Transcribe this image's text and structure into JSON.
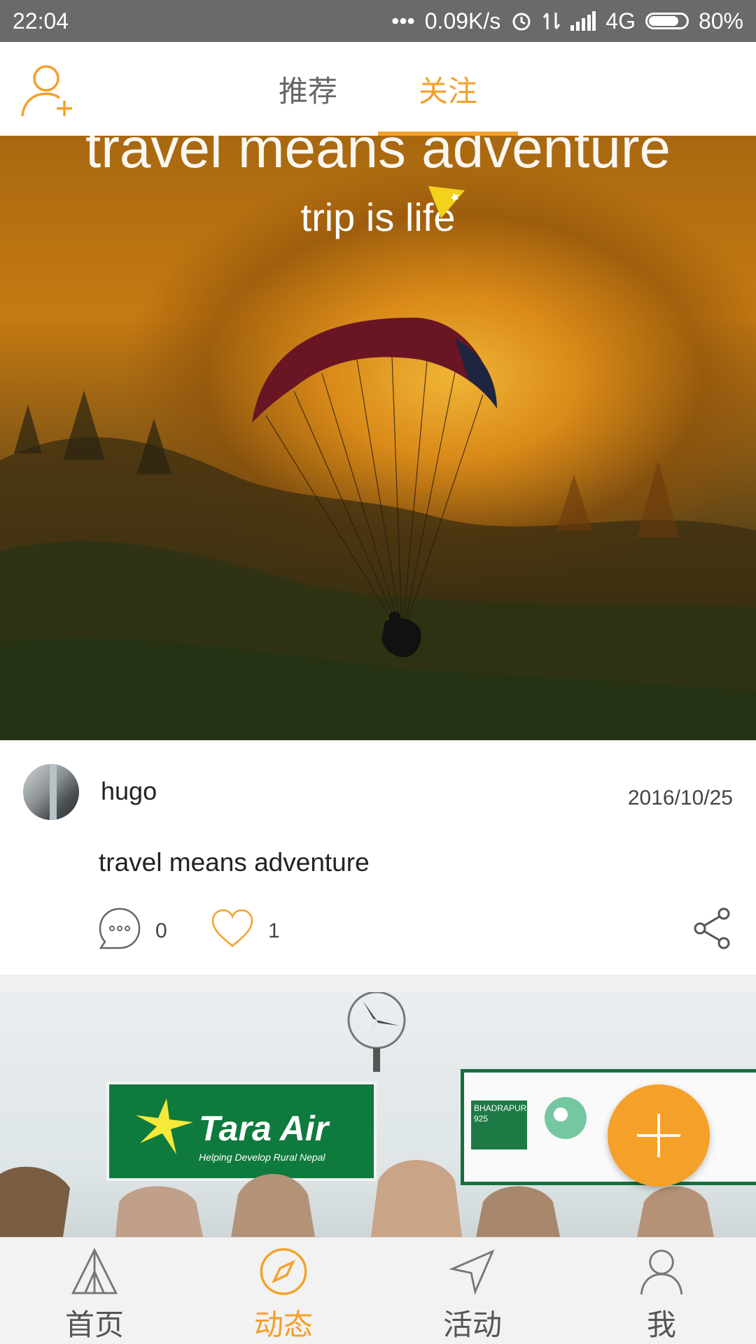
{
  "status_bar": {
    "time": "22:04",
    "network_speed": "0.09K/s",
    "network_type": "4G",
    "battery": "80%",
    "battery_level": 0.8
  },
  "header": {
    "tabs": [
      {
        "label": "推荐",
        "active": false
      },
      {
        "label": "关注",
        "active": true
      }
    ],
    "add_user_icon": "add-user-icon"
  },
  "posts": [
    {
      "image_caption": "travel means adventure",
      "image_brand": "trip is life",
      "username": "hugo",
      "date": "2016/10/25",
      "text": "travel means adventure",
      "comments": "0",
      "likes": "1"
    },
    {
      "sign_title": "Tara Air",
      "sign_subtitle": "Helping Develop Rural Nepal",
      "sign_bhadrapur": "BHADRAPUR",
      "sign_flight": "925"
    }
  ],
  "fab": {
    "icon": "plus-icon"
  },
  "bottom_nav": [
    {
      "label": "首页",
      "icon": "tent-icon",
      "active": false
    },
    {
      "label": "动态",
      "icon": "compass-icon",
      "active": true
    },
    {
      "label": "活动",
      "icon": "navigation-icon",
      "active": false
    },
    {
      "label": "我",
      "icon": "user-icon",
      "active": false
    }
  ],
  "colors": {
    "accent": "#f5a028",
    "status_bar": "#6a6a6a",
    "nav_background": "#f2f2f2"
  }
}
